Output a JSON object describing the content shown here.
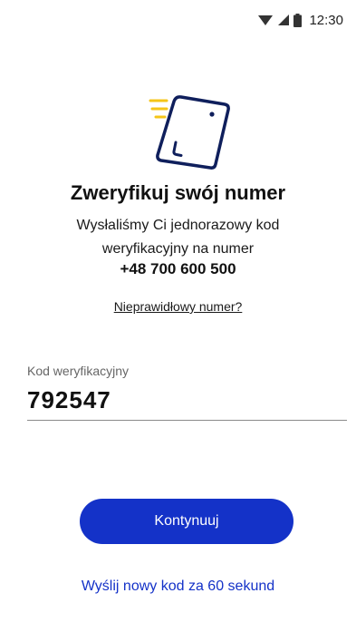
{
  "status_bar": {
    "time": "12:30",
    "icons": [
      "wifi-icon",
      "signal-icon",
      "battery-icon"
    ]
  },
  "hero": {
    "icon": "phone-verification-icon"
  },
  "title": "Zweryfikuj swój numer",
  "description": "Wysłaliśmy Ci jednorazowy kod weryfikacyjny na numer",
  "phone_number": "+48 700 600 500",
  "wrong_number_link": "Nieprawidłowy numer?",
  "code_field": {
    "label": "Kod weryfikacyjny",
    "value": "792547"
  },
  "continue_button": "Kontynuuj",
  "resend_link": "Wyślij nowy kod za 60 sekund",
  "colors": {
    "primary": "#1432c8",
    "icon_navy": "#0f1f5c",
    "accent_yellow": "#f5c518",
    "text": "#111111",
    "label_gray": "#666666"
  }
}
